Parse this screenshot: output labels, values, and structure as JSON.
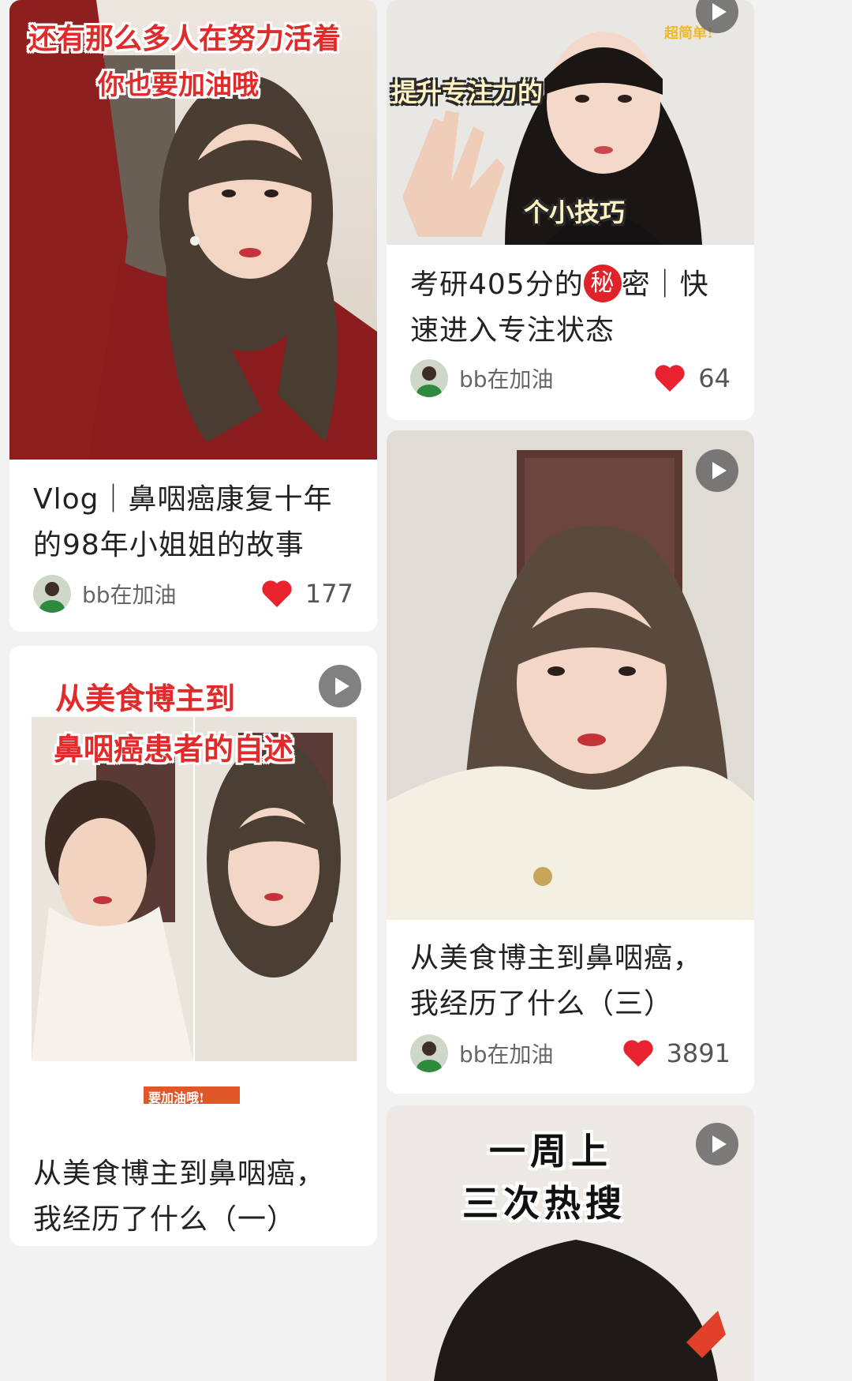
{
  "feed": {
    "cards": [
      {
        "title": "Vlog｜鼻咽癌康复十年的98年小姐姐的故事",
        "author": "bb在加油",
        "likes": "177",
        "overlay": [
          "还有那么多人在努力活着",
          "你也要加油哦"
        ]
      },
      {
        "title": "从美食博主到鼻咽癌，我经历了什么（一）",
        "overlay": [
          "从美食博主到",
          "鼻咽癌患者的自述",
          "要加油哦!"
        ]
      },
      {
        "title_before": "考研405分的",
        "title_badge": "秘",
        "title_after": "密｜快速进入专注状态",
        "author": "bb在加油",
        "likes": "64",
        "overlay": [
          "提升专注力的",
          "个小技巧",
          "超简单!"
        ]
      },
      {
        "title": "从美食博主到鼻咽癌，我经历了什么（三）",
        "author": "bb在加油",
        "likes": "3891"
      },
      {
        "overlay": [
          "一周上",
          "三次热搜"
        ]
      }
    ]
  },
  "colors": {
    "heart": "#e8222f",
    "caption_red": "#e12a2a",
    "background": "#f2f2f2"
  },
  "icons": {
    "play": "play-icon",
    "like": "heart-icon"
  }
}
